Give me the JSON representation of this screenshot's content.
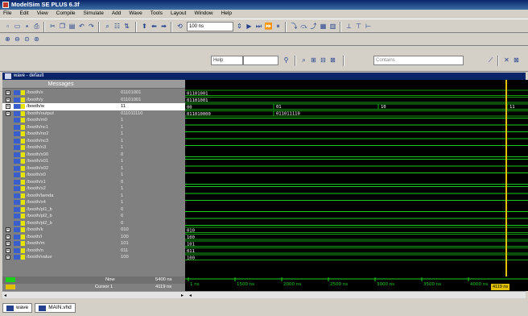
{
  "app": {
    "title": "ModelSim SE PLUS 6.3f"
  },
  "menu": [
    "File",
    "Edit",
    "View",
    "Compile",
    "Simulate",
    "Add",
    "Wave",
    "Tools",
    "Layout",
    "Window",
    "Help"
  ],
  "toolbar": {
    "run_length": "100 ns",
    "help_placeholder": "Help",
    "contains_placeholder": "Contains"
  },
  "window": {
    "title": "wave - default"
  },
  "panes": {
    "messages_header": "Messages"
  },
  "signals": [
    {
      "name": "/booth/x",
      "value": "01101001",
      "expand": "+",
      "wave": "01101001",
      "type": "bus"
    },
    {
      "name": "/booth/y",
      "value": "01101001",
      "expand": "+",
      "wave": "01101001",
      "type": "bus"
    },
    {
      "name": "/booth/w",
      "value": "11",
      "expand": "+",
      "wave": "00",
      "type": "bus",
      "selected": true
    },
    {
      "name": "/booth/output",
      "value": "011011110",
      "expand": "+",
      "wave": "011010000",
      "type": "bus"
    },
    {
      "name": "/booth/m0",
      "value": "1",
      "type": "bit",
      "level": 1
    },
    {
      "name": "/booth/nc1",
      "value": "1",
      "type": "bit",
      "level": 1
    },
    {
      "name": "/booth/no2",
      "value": "1",
      "type": "bit",
      "level": 1
    },
    {
      "name": "/booth/nc3",
      "value": "1",
      "type": "bit",
      "level": 1
    },
    {
      "name": "/booth/n3",
      "value": "1",
      "type": "bit",
      "level": 1
    },
    {
      "name": "/booth/x00",
      "value": "0",
      "type": "bit",
      "level": 0
    },
    {
      "name": "/booth/x01",
      "value": "1",
      "type": "bit",
      "level": 1
    },
    {
      "name": "/booth/x02",
      "value": "1",
      "type": "bit",
      "level": 1
    },
    {
      "name": "/booth/x0",
      "value": "1",
      "type": "bit",
      "level": 1
    },
    {
      "name": "/booth/x1",
      "value": "0",
      "type": "bit",
      "level": 0
    },
    {
      "name": "/booth/x2",
      "value": "1",
      "type": "bit",
      "level": 1
    },
    {
      "name": "/booth/lamda",
      "value": "1",
      "type": "bit",
      "level": 1
    },
    {
      "name": "/booth/x4",
      "value": "1",
      "type": "bit",
      "level": 1
    },
    {
      "name": "/booth/pl1_b",
      "value": "0",
      "type": "bit",
      "level": 0
    },
    {
      "name": "/booth/pl2_b",
      "value": "0",
      "type": "bit",
      "level": 0
    },
    {
      "name": "/booth/pl2_b",
      "value": "0",
      "type": "bit",
      "level": 0
    },
    {
      "name": "/booth/k",
      "value": "010",
      "expand": "+",
      "wave": "010",
      "type": "bus"
    },
    {
      "name": "/booth/l",
      "value": "100",
      "expand": "+",
      "wave": "100",
      "type": "bus"
    },
    {
      "name": "/booth/m",
      "value": "101",
      "expand": "+",
      "wave": "101",
      "type": "bus"
    },
    {
      "name": "/booth/n",
      "value": "011",
      "expand": "+",
      "wave": "011",
      "type": "bus"
    },
    {
      "name": "/booth/value",
      "value": "100",
      "expand": "+",
      "wave": "100",
      "type": "bus"
    }
  ],
  "wave_annotations": {
    "w_transitions": [
      "01",
      "10",
      "11"
    ],
    "output_change": "011011110"
  },
  "status": {
    "now_label": "Now",
    "now_value": "5400 ns",
    "cursor_label": "Cursor 1",
    "cursor_value": "4119 ns",
    "cursor_marker": "4119 ns"
  },
  "timeline": {
    "ticks": [
      "1 ns",
      "1500 ns",
      "2000 ns",
      "2500 ns",
      "3000 ns",
      "3500 ns",
      "4000 ns"
    ]
  },
  "tabs": [
    {
      "label": "wave"
    },
    {
      "label": "MAIN.vhd"
    }
  ],
  "colors": {
    "wave_green": "#1ad11a",
    "cursor_yellow": "#e0c000",
    "titlebar": "#0a246a"
  }
}
